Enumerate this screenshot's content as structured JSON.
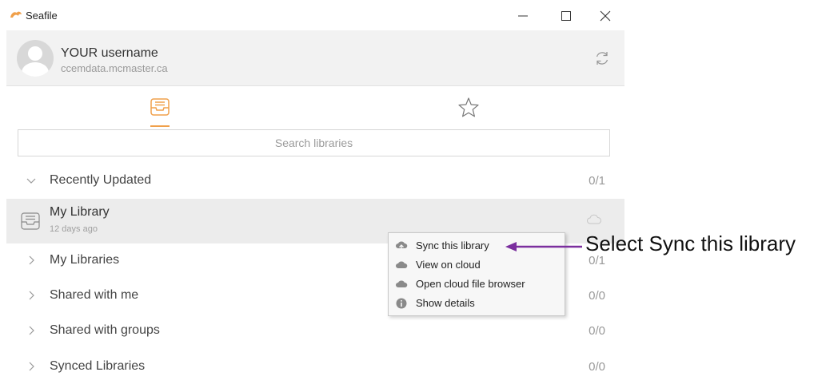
{
  "window": {
    "title": "Seafile",
    "controls": {
      "minimize": "—",
      "maximize": "☐",
      "close": "✕"
    }
  },
  "account": {
    "name": "YOUR username",
    "server": "ccemdata.mcmaster.ca"
  },
  "tabs": [
    {
      "name": "libraries-tab",
      "icon": "library-tray-icon",
      "active": true
    },
    {
      "name": "starred-tab",
      "icon": "star-icon",
      "active": false
    }
  ],
  "search": {
    "placeholder": "Search libraries",
    "value": ""
  },
  "groups": {
    "recent": {
      "label": "Recently Updated",
      "count": "0/1",
      "expanded": true
    },
    "my_libraries": {
      "label": "My Libraries",
      "count": "0/1",
      "expanded": false
    },
    "shared_with_me": {
      "label": "Shared with me",
      "count": "0/0",
      "expanded": false
    },
    "shared_with_groups": {
      "label": "Shared with groups",
      "count": "0/0",
      "expanded": false
    },
    "synced": {
      "label": "Synced Libraries",
      "count": "0/0",
      "expanded": false
    }
  },
  "library": {
    "name": "My Library",
    "updated": "12 days ago"
  },
  "context_menu": {
    "items": [
      {
        "label": "Sync this library",
        "icon": "cloud-sync-icon"
      },
      {
        "label": "View on cloud",
        "icon": "cloud-icon"
      },
      {
        "label": "Open cloud file browser",
        "icon": "cloud-icon"
      },
      {
        "label": "Show details",
        "icon": "info-icon"
      }
    ]
  },
  "annotation": {
    "text": "Select Sync this library"
  },
  "colors": {
    "accent": "#f0a04b",
    "annotation_arrow": "#7b2f9e",
    "selected_row": "#ececec"
  }
}
